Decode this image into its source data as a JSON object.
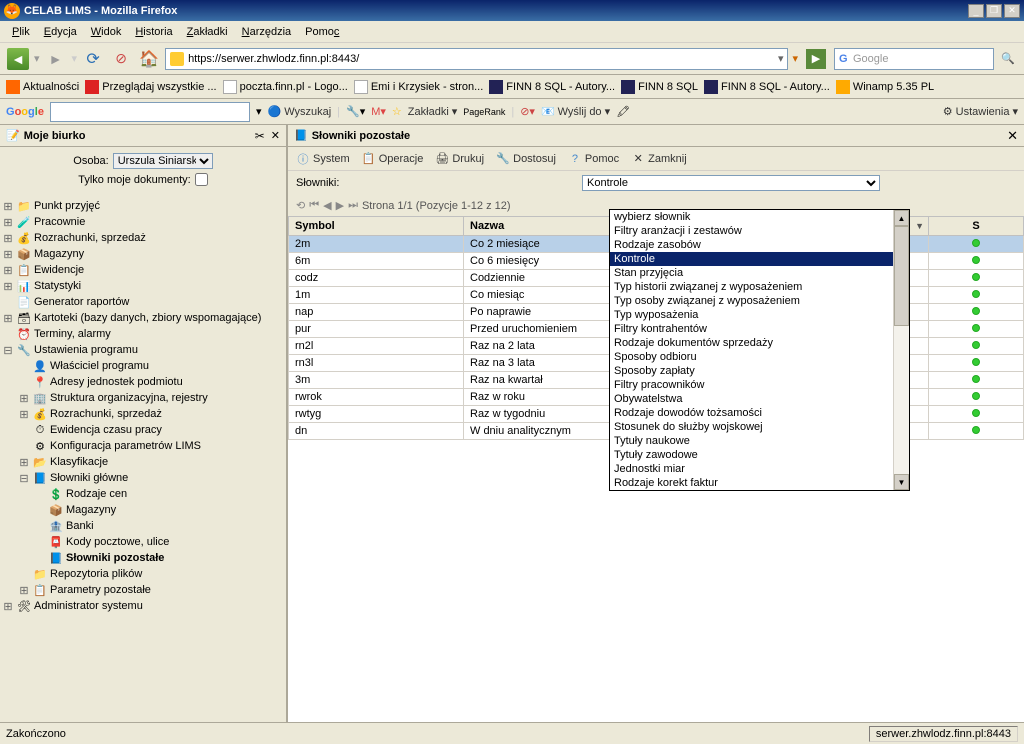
{
  "window": {
    "title": "CELAB LIMS - Mozilla Firefox"
  },
  "menubar": {
    "plik": "Plik",
    "edycja": "Edycja",
    "widok": "Widok",
    "historia": "Historia",
    "zakladki": "Zakładki",
    "narzedzia": "Narzędzia",
    "pomoc": "Pomoc"
  },
  "navbar": {
    "url": "https://serwer.zhwlodz.finn.pl:8443/",
    "search_placeholder": "Google"
  },
  "bookmarks": {
    "b0": "Aktualności",
    "b1": "Przeglądaj wszystkie ...",
    "b2": "poczta.finn.pl - Logo...",
    "b3": "Emi i Krzysiek - stron...",
    "b4": "FINN 8 SQL - Autory...",
    "b5": "FINN 8 SQL",
    "b6": "FINN 8 SQL - Autory...",
    "b7": "Winamp 5.35 PL"
  },
  "google": {
    "wyszukaj": "Wyszukaj",
    "zakladki": "Zakładki",
    "pagerank": "PageRank",
    "wyslij": "Wyślij do",
    "ustawienia": "Ustawienia"
  },
  "sidebar": {
    "title": "Moje biurko",
    "osoba_label": "Osoba:",
    "osoba_value": "Urszula Siniarska",
    "tylko_moje": "Tylko moje dokumenty:",
    "items": {
      "punkt": "Punkt przyjęć",
      "pracownie": "Pracownie",
      "rozrachunki": "Rozrachunki, sprzedaż",
      "magazyny": "Magazyny",
      "ewidencje": "Ewidencje",
      "statystyki": "Statystyki",
      "generator": "Generator raportów",
      "kartoteki": "Kartoteki (bazy danych, zbiory wspomagające)",
      "terminy": "Terminy, alarmy",
      "ustawienia": "Ustawienia programu",
      "wlasciciel": "Właściciel programu",
      "adresy": "Adresy jednostek podmiotu",
      "struktura": "Struktura organizacyjna, rejestry",
      "rozrachunki2": "Rozrachunki, sprzedaż",
      "ewidencja_czasu": "Ewidencja czasu pracy",
      "konfiguracja": "Konfiguracja parametrów LIMS",
      "klasyfikacje": "Klasyfikacje",
      "slowniki": "Słowniki główne",
      "rodzaje_cen": "Rodzaje cen",
      "magazyny2": "Magazyny",
      "banki": "Banki",
      "kody": "Kody pocztowe, ulice",
      "slowniki_poz": "Słowniki pozostałe",
      "repozytoria": "Repozytoria plików",
      "parametry": "Parametry pozostałe",
      "admin": "Administrator systemu"
    }
  },
  "panel": {
    "title": "Słowniki pozostałe",
    "toolbar": {
      "system": "System",
      "operacje": "Operacje",
      "drukuj": "Drukuj",
      "dostosuj": "Dostosuj",
      "pomoc": "Pomoc",
      "zamknij": "Zamknij"
    },
    "slowniki_label": "Słowniki:",
    "slowniki_value": "Kontrole",
    "pager": "Strona 1/1 (Pozycje 1-12 z 12)",
    "headers": {
      "symbol": "Symbol",
      "nazwa": "Nazwa",
      "s": "S"
    },
    "rows": [
      {
        "symbol": "2m",
        "nazwa": "Co 2 miesiące"
      },
      {
        "symbol": "6m",
        "nazwa": "Co 6 miesięcy"
      },
      {
        "symbol": "codz",
        "nazwa": "Codziennie"
      },
      {
        "symbol": "1m",
        "nazwa": "Co miesiąc"
      },
      {
        "symbol": "nap",
        "nazwa": "Po naprawie"
      },
      {
        "symbol": "pur",
        "nazwa": "Przed uruchomieniem"
      },
      {
        "symbol": "rn2l",
        "nazwa": "Raz na 2 lata"
      },
      {
        "symbol": "rn3l",
        "nazwa": "Raz na 3 lata"
      },
      {
        "symbol": "3m",
        "nazwa": "Raz na kwartał"
      },
      {
        "symbol": "rwrok",
        "nazwa": "Raz w roku"
      },
      {
        "symbol": "rwtyg",
        "nazwa": "Raz w tygodniu"
      },
      {
        "symbol": "dn",
        "nazwa": "W dniu analitycznym"
      }
    ]
  },
  "dropdown": {
    "items": [
      "wybierz słownik",
      "Filtry aranżacji i zestawów",
      "Rodzaje zasobów",
      "Kontrole",
      "Stan przyjęcia",
      "Typ historii związanej z wyposażeniem",
      "Typ osoby związanej z wyposażeniem",
      "Typ wyposażenia",
      "Filtry kontrahentów",
      "Rodzaje dokumentów sprzedaży",
      "Sposoby odbioru",
      "Sposoby zapłaty",
      "Filtry pracowników",
      "Obywatelstwa",
      "Rodzaje dowodów tożsamości",
      "Stosunek do służby wojskowej",
      "Tytuły naukowe",
      "Tytuły zawodowe",
      "Jednostki miar",
      "Rodzaje korekt faktur"
    ],
    "selected_index": 3
  },
  "statusbar": {
    "left": "Zakończono",
    "right": "serwer.zhwlodz.finn.pl:8443"
  }
}
